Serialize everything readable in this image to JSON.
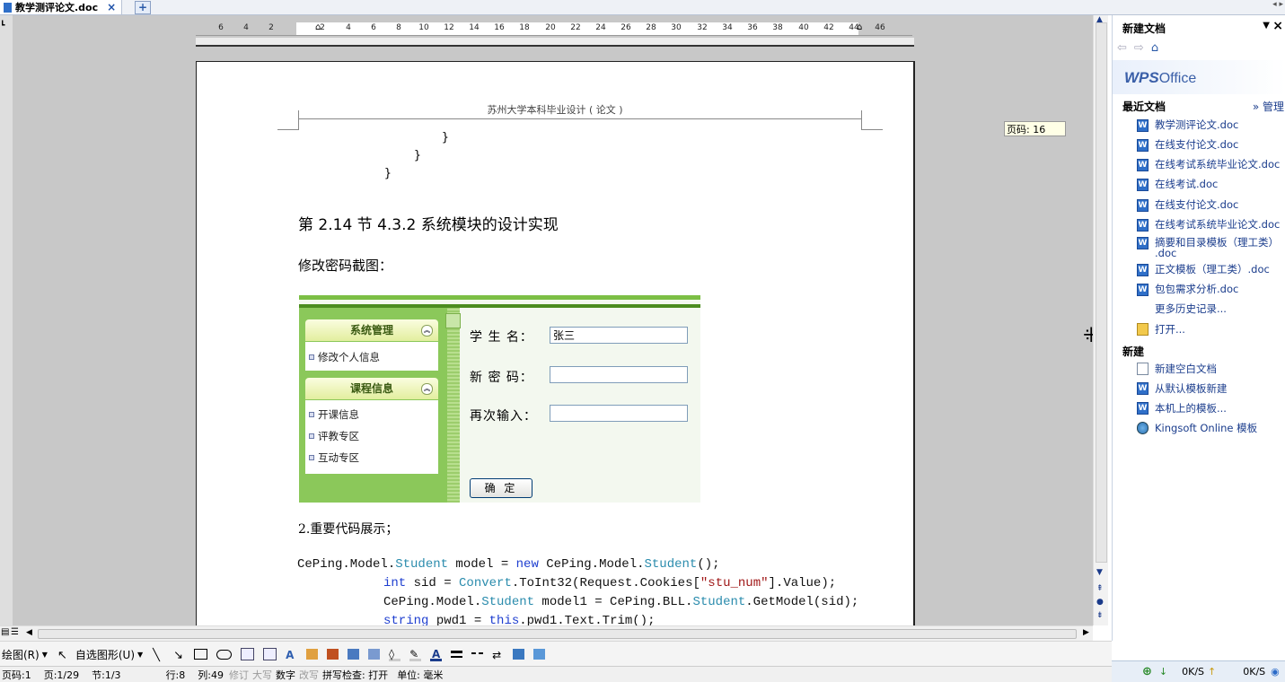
{
  "tabs": {
    "doc_title": "教学测评论文.doc",
    "close": "×",
    "new": "+"
  },
  "ruler": {
    "ticks": [
      "6",
      "4",
      "2",
      "2",
      "4",
      "6",
      "8",
      "10",
      "12",
      "14",
      "16",
      "18",
      "20",
      "22",
      "24",
      "26",
      "28",
      "30",
      "32",
      "34",
      "36",
      "38",
      "40",
      "42",
      "44",
      "46"
    ]
  },
  "page": {
    "header": "苏州大学本科毕业设计 ( 论文 )",
    "braces": [
      "}",
      "}",
      "}"
    ],
    "section_title": "第 2.14 节  4.3.2  系统模块的设计实现",
    "caption": "修改密码截图：",
    "code_heading": "2.重要代码展示；",
    "screenshot": {
      "panel1_title": "系统管理",
      "panel1_items": [
        "修改个人信息"
      ],
      "panel2_title": "课程信息",
      "panel2_items": [
        "开课信息",
        "评教专区",
        "互动专区"
      ],
      "label_name": "学 生 名：",
      "value_name": "张三",
      "label_newpw": "新 密 码：",
      "label_repeat": "再次输入：",
      "ok_button": "确 定"
    },
    "code_lines": [
      [
        [
          "CePing.Model.",
          ""
        ],
        [
          "Student",
          "ty"
        ],
        [
          " model = ",
          ""
        ],
        [
          "new",
          "kw"
        ],
        [
          " CePing.Model.",
          ""
        ],
        [
          "Student",
          "ty"
        ],
        [
          "();",
          ""
        ]
      ],
      [
        [
          "int",
          "kw"
        ],
        [
          " sid = ",
          ""
        ],
        [
          "Convert",
          "ty"
        ],
        [
          ".ToInt32(Request.Cookies[",
          ""
        ],
        [
          "\"stu_num\"",
          "st"
        ],
        [
          "].Value);",
          ""
        ]
      ],
      [
        [
          "CePing.Model.",
          ""
        ],
        [
          "Student",
          "ty"
        ],
        [
          " model1 = CePing.BLL.",
          ""
        ],
        [
          "Student",
          "ty"
        ],
        [
          ".GetModel(sid);",
          ""
        ]
      ],
      [
        [
          "string",
          "kw"
        ],
        [
          " pwd1 = ",
          ""
        ],
        [
          "this",
          "kw"
        ],
        [
          ".pwd1.Text.Trim();",
          ""
        ]
      ]
    ]
  },
  "page_number_tip": "页码: 16",
  "draw_toolbar": {
    "draw": "绘图(R)",
    "autoshape": "自选图形(U)"
  },
  "status": {
    "page": "页码:1",
    "pages": "页:1/29",
    "section": "节:1/3",
    "row": "行:8",
    "col": "列:49",
    "revise": "修订",
    "caps": "大写",
    "num": "数字",
    "overwrite": "改写",
    "spell": "拼写检查: 打开",
    "unit": "单位: 毫米"
  },
  "pane": {
    "title": "新建文档",
    "logo_main": "WPS",
    "logo_sub": "Office",
    "recent_header": "最近文档",
    "manage": "» 管理",
    "recent_docs": [
      "教学测评论文.doc",
      "在线支付论文.doc",
      "在线考试系统毕业论文.doc",
      "在线考试.doc",
      "在线支付论文.doc",
      "在线考试系统毕业论文.doc",
      "摘要和目录模板（理工类）",
      "正文模板（理工类）.doc",
      "包包需求分析.doc"
    ],
    "recent_doc_7_line2": ".doc",
    "more_history": "更多历史记录...",
    "open": "打开...",
    "new_header": "新建",
    "new_items": [
      "新建空白文档",
      "从默认模板新建",
      "本机上的模板...",
      "Kingsoft Online 模板"
    ]
  },
  "tray": {
    "down": "0K/S",
    "up": "0K/S"
  }
}
